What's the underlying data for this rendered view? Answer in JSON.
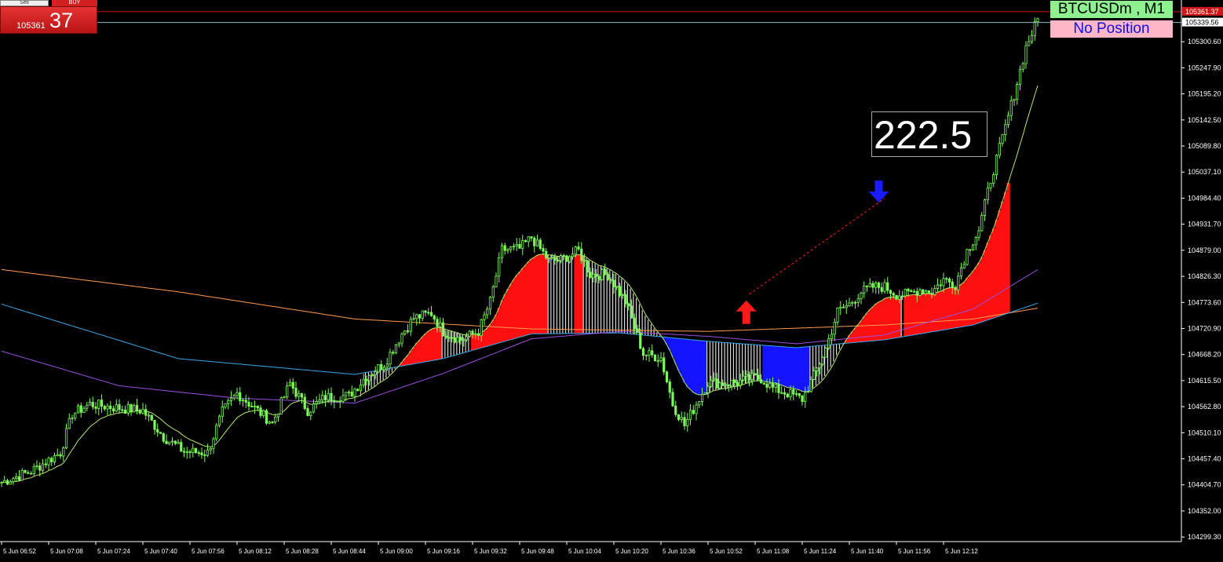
{
  "trade_panel": {
    "sell_label": "Sell",
    "buy_label": "BUY",
    "buy_price_main": "105361",
    "buy_price_big": "37"
  },
  "labels": {
    "symbol": "BTCUSDm , M1",
    "position": "No Position",
    "counter": "222.5"
  },
  "price_axis": {
    "ticks": [
      "105300.60",
      "105247.90",
      "105195.20",
      "105142.50",
      "105089.80",
      "105037.10",
      "104984.40",
      "104931.70",
      "104879.00",
      "104826.30",
      "104773.60",
      "104720.90",
      "104668.20",
      "104615.50",
      "104562.80",
      "104510.10",
      "104457.40",
      "104404.70",
      "104352.00",
      "104299.30"
    ],
    "bid_tag": "105361.37",
    "ask_tag": "105339.56"
  },
  "colors": {
    "background": "#000000",
    "candle": "#7cfc5a",
    "bull_fill": "#ff1010",
    "bear_fill": "#1414ff",
    "bid_line": "#d21414",
    "ask_line": "#8fb7c6",
    "ma_fast": "#b5e86a",
    "ma_slow_orange": "#ff9b50",
    "ma_blue": "#3aa9e8",
    "ma_purple": "#9b4ee0"
  },
  "chart_data": {
    "type": "candlestick",
    "symbol": "BTCUSDm",
    "timeframe": "M1",
    "ylim": [
      104290,
      105385
    ],
    "bid": 105361.37,
    "ask": 105339.56,
    "time_labels": [
      "5 Jun 06:52",
      "5 Jun 07:08",
      "5 Jun 07:24",
      "5 Jun 07:40",
      "5 Jun 07:56",
      "5 Jun 08:12",
      "5 Jun 08:28",
      "5 Jun 08:44",
      "5 Jun 09:00",
      "5 Jun 09:16",
      "5 Jun 09:32",
      "5 Jun 09:48",
      "5 Jun 10:04",
      "5 Jun 10:20",
      "5 Jun 10:36",
      "5 Jun 10:52",
      "5 Jun 11:08",
      "5 Jun 11:24",
      "5 Jun 11:40",
      "5 Jun 11:56",
      "5 Jun 12:12"
    ],
    "price_path": [
      [
        0,
        104410
      ],
      [
        10,
        104432
      ],
      [
        20,
        104470
      ],
      [
        24,
        104548
      ],
      [
        30,
        104568
      ],
      [
        40,
        104560
      ],
      [
        48,
        104555
      ],
      [
        55,
        104502
      ],
      [
        62,
        104472
      ],
      [
        70,
        104470
      ],
      [
        75,
        104552
      ],
      [
        80,
        104590
      ],
      [
        86,
        104560
      ],
      [
        92,
        104530
      ],
      [
        98,
        104610
      ],
      [
        104,
        104555
      ],
      [
        110,
        104582
      ],
      [
        118,
        104585
      ],
      [
        124,
        104625
      ],
      [
        130,
        104650
      ],
      [
        136,
        104710
      ],
      [
        140,
        104742
      ],
      [
        146,
        104752
      ],
      [
        150,
        104715
      ],
      [
        156,
        104698
      ],
      [
        162,
        104715
      ],
      [
        166,
        104775
      ],
      [
        170,
        104880
      ],
      [
        176,
        104882
      ],
      [
        180,
        104905
      ],
      [
        186,
        104858
      ],
      [
        190,
        104860
      ],
      [
        196,
        104878
      ],
      [
        200,
        104830
      ],
      [
        206,
        104830
      ],
      [
        212,
        104775
      ],
      [
        218,
        104670
      ],
      [
        224,
        104662
      ],
      [
        228,
        104568
      ],
      [
        232,
        104525
      ],
      [
        240,
        104612
      ],
      [
        244,
        104610
      ],
      [
        250,
        104612
      ],
      [
        254,
        104620
      ],
      [
        258,
        104620
      ],
      [
        262,
        104600
      ],
      [
        268,
        104588
      ],
      [
        272,
        104578
      ],
      [
        276,
        104625
      ],
      [
        280,
        104680
      ],
      [
        284,
        104755
      ],
      [
        288,
        104770
      ],
      [
        292,
        104795
      ],
      [
        296,
        104805
      ],
      [
        300,
        104805
      ],
      [
        304,
        104790
      ],
      [
        308,
        104790
      ],
      [
        312,
        104800
      ],
      [
        316,
        104795
      ],
      [
        320,
        104820
      ],
      [
        324,
        104810
      ],
      [
        328,
        104878
      ],
      [
        332,
        104920
      ],
      [
        336,
        105022
      ],
      [
        340,
        105105
      ],
      [
        344,
        105195
      ],
      [
        348,
        105290
      ],
      [
        352,
        105345
      ]
    ],
    "moving_averages": [
      {
        "color_key": "ma_slow_orange",
        "points": [
          [
            0,
            104840
          ],
          [
            60,
            104795
          ],
          [
            120,
            104740
          ],
          [
            180,
            104720
          ],
          [
            240,
            104715
          ],
          [
            300,
            104728
          ],
          [
            330,
            104740
          ],
          [
            352,
            104762
          ]
        ]
      },
      {
        "color_key": "ma_blue",
        "points": [
          [
            0,
            104770
          ],
          [
            60,
            104660
          ],
          [
            120,
            104628
          ],
          [
            150,
            104660
          ],
          [
            180,
            104710
          ],
          [
            210,
            104712
          ],
          [
            240,
            104695
          ],
          [
            270,
            104682
          ],
          [
            300,
            104698
          ],
          [
            330,
            104728
          ],
          [
            352,
            104772
          ]
        ]
      },
      {
        "color_key": "ma_purple",
        "points": [
          [
            0,
            104675
          ],
          [
            40,
            104605
          ],
          [
            80,
            104580
          ],
          [
            120,
            104570
          ],
          [
            150,
            104630
          ],
          [
            180,
            104700
          ],
          [
            210,
            104715
          ],
          [
            240,
            104705
          ],
          [
            270,
            104690
          ],
          [
            300,
            104708
          ],
          [
            330,
            104760
          ],
          [
            352,
            104840
          ]
        ]
      }
    ],
    "signals": [
      {
        "type": "buy",
        "x": 253,
        "price": 104730
      },
      {
        "type": "sell",
        "x": 298,
        "price": 105020
      }
    ],
    "trend_line": [
      [
        254,
        104790
      ],
      [
        300,
        104984
      ]
    ]
  }
}
